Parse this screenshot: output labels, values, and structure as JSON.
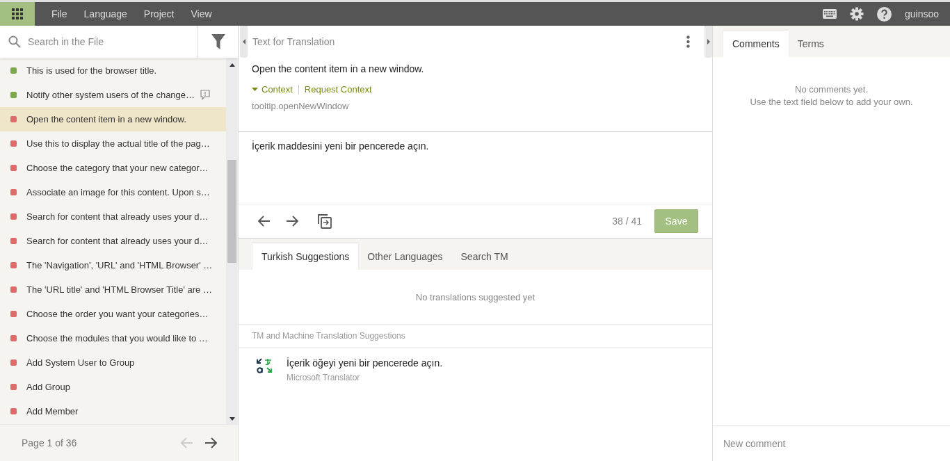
{
  "menu": {
    "items": [
      "File",
      "Language",
      "Project",
      "View"
    ],
    "user": "guinsoo"
  },
  "sidebar": {
    "search": {
      "placeholder": "Search in the File"
    },
    "items": [
      {
        "text": "This is used for the browser title.",
        "color": "#7aa84a",
        "has_comment": false,
        "selected": false
      },
      {
        "text": "Notify other system users of the change…",
        "color": "#7aa84a",
        "has_comment": true,
        "selected": false
      },
      {
        "text": "Open the content item in a new window.",
        "color": "#e06a6a",
        "has_comment": false,
        "selected": true
      },
      {
        "text": "Use this to display the actual title of the pag…",
        "color": "#e06a6a",
        "has_comment": false,
        "selected": false
      },
      {
        "text": "Choose the category that your new categor…",
        "color": "#e06a6a",
        "has_comment": false,
        "selected": false
      },
      {
        "text": "Associate an image for this content. Upon s…",
        "color": "#e06a6a",
        "has_comment": false,
        "selected": false
      },
      {
        "text": "Search for content that already uses your d…",
        "color": "#e06a6a",
        "has_comment": false,
        "selected": false
      },
      {
        "text": "Search for content that already uses your d…",
        "color": "#e06a6a",
        "has_comment": false,
        "selected": false
      },
      {
        "text": "The 'Navigation', 'URL' and 'HTML Browser' …",
        "color": "#e06a6a",
        "has_comment": false,
        "selected": false
      },
      {
        "text": "The 'URL title' and 'HTML Browser Title' are …",
        "color": "#e06a6a",
        "has_comment": false,
        "selected": false
      },
      {
        "text": "Choose the order you want your categories…",
        "color": "#e06a6a",
        "has_comment": false,
        "selected": false
      },
      {
        "text": "Choose the modules that you would like to …",
        "color": "#e06a6a",
        "has_comment": false,
        "selected": false
      },
      {
        "text": "Add System User to Group",
        "color": "#e06a6a",
        "has_comment": false,
        "selected": false
      },
      {
        "text": "Add Group",
        "color": "#e06a6a",
        "has_comment": false,
        "selected": false
      },
      {
        "text": "Add Member",
        "color": "#e06a6a",
        "has_comment": false,
        "selected": false
      }
    ],
    "pagination": "Page 1 of 36"
  },
  "source": {
    "title": "Text for Translation",
    "text": "Open the content item in a new window.",
    "context_link": "Context",
    "request_link": "Request Context",
    "key": "tooltip.openNewWindow"
  },
  "editor": {
    "value": "İçerik maddesini yeni bir pencerede açın.",
    "counter": "38 / 41",
    "save": "Save"
  },
  "suggestions": {
    "tabs": [
      {
        "label": "Turkish Suggestions",
        "selected": true
      },
      {
        "label": "Other Languages",
        "selected": false
      },
      {
        "label": "Search TM",
        "selected": false
      }
    ],
    "empty": "No translations suggested yet",
    "section": "TM and Machine Translation Suggestions",
    "items": [
      {
        "text": "İçerik öğeyi yeni bir pencerede açın.",
        "source": "Microsoft Translator"
      }
    ]
  },
  "comments": {
    "tabs": [
      {
        "label": "Comments",
        "selected": true
      },
      {
        "label": "Terms",
        "selected": false
      }
    ],
    "empty": [
      "No comments yet.",
      "Use the text field below to add your own."
    ],
    "new_comment": {
      "placeholder": "New comment"
    }
  }
}
